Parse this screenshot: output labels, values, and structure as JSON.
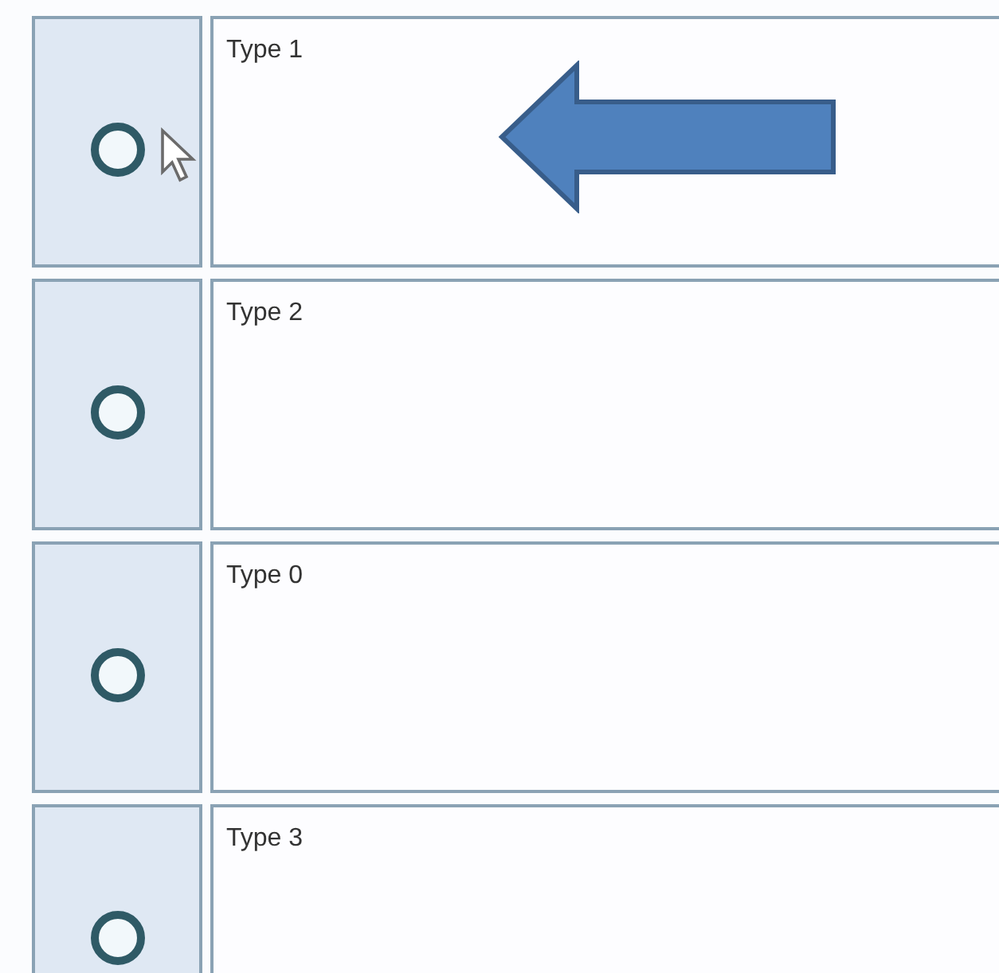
{
  "rows": [
    {
      "label": "Type 1",
      "selected": false,
      "arrow": true
    },
    {
      "label": "Type 2",
      "selected": false,
      "arrow": false
    },
    {
      "label": "Type 0",
      "selected": false,
      "arrow": false
    },
    {
      "label": "Type 3",
      "selected": false,
      "arrow": false
    }
  ]
}
